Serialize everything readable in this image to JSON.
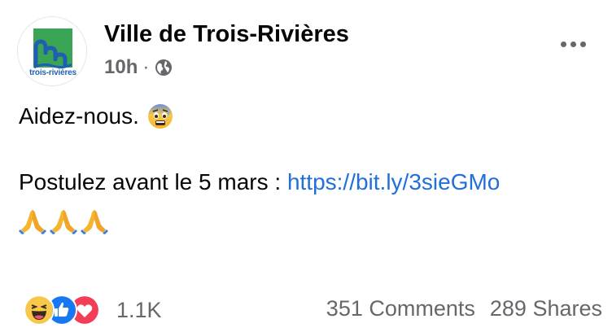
{
  "post": {
    "page_name": "Ville de Trois-Rivières",
    "time": "10h",
    "separator": "·",
    "audience_icon": "globe-icon",
    "avatar_text": "trois-rivières",
    "line1": "Aidez-nous.",
    "line1_emoji": "anxious-face-emoji",
    "line2_prefix": "Postulez avant le 5 mars : ",
    "link": "https://bit.ly/3sieGMo",
    "emoji_row": [
      "folded-hands-emoji",
      "folded-hands-emoji",
      "folded-hands-emoji"
    ]
  },
  "footer": {
    "reactions": [
      "haha",
      "like",
      "love"
    ],
    "reaction_count": "1.1K",
    "comments": "351 Comments",
    "shares": "289 Shares"
  },
  "colors": {
    "link": "#216fdb",
    "secondary_text": "#65676b",
    "like_blue": "#1877f2",
    "love_red": "#f33e58",
    "logo_green": "#3aa655",
    "logo_blue": "#1f5fb0"
  }
}
